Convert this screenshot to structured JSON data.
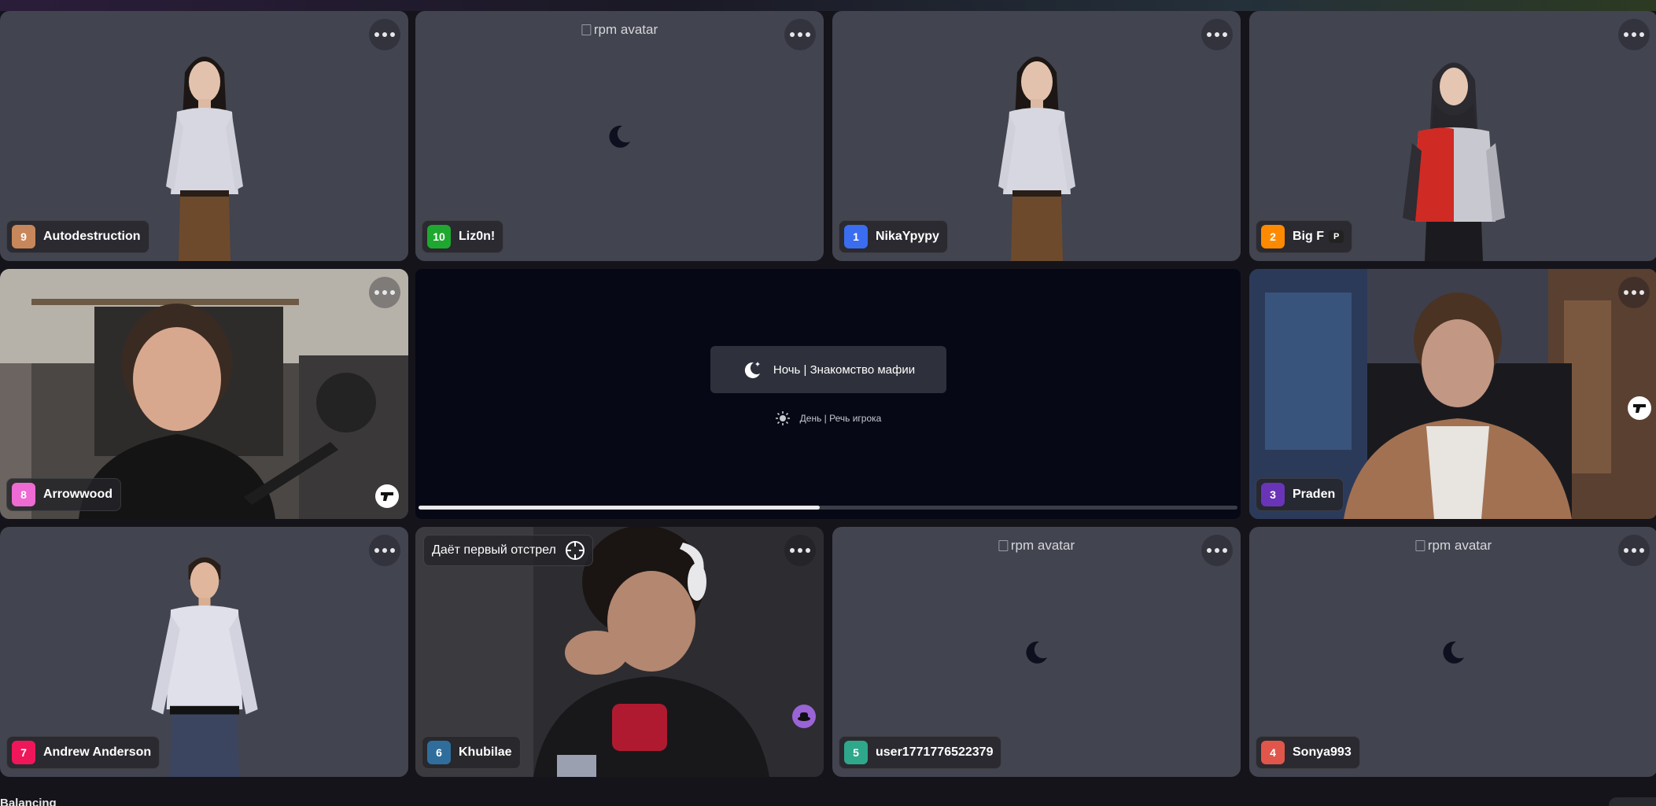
{
  "tiles": [
    {
      "id": 9,
      "name": "Autodestruction",
      "color": "#c8875a",
      "type": "avatar"
    },
    {
      "id": 10,
      "name": "Liz0n!",
      "color": "#1fa82f",
      "type": "broken",
      "alt": "rpm avatar"
    },
    {
      "id": 1,
      "name": "NikaYpypy",
      "color": "#3a6df0",
      "type": "avatar"
    },
    {
      "id": 2,
      "name": "Big F",
      "color": "#ff8a00",
      "type": "avatar",
      "badge": "P"
    },
    {
      "id": 8,
      "name": "Arrowwood",
      "color": "#ee6bd3",
      "type": "camera",
      "icon": "gun-icon"
    },
    {
      "id": 3,
      "name": "Praden",
      "color": "#6a34b8",
      "type": "camera",
      "icon": "gun-icon"
    },
    {
      "id": 7,
      "name": "Andrew Anderson",
      "color": "#f0165a",
      "type": "avatar"
    },
    {
      "id": 6,
      "name": "Khubilae",
      "color": "#2f6e9c",
      "type": "camera",
      "icon": "hat-icon",
      "overlay": "Даёт первый отстрел"
    },
    {
      "id": 5,
      "name": "user1771776522379",
      "color": "#2fa78a",
      "type": "broken",
      "alt": "rpm avatar"
    },
    {
      "id": 4,
      "name": "Sonya993",
      "color": "#e0564a",
      "type": "broken",
      "alt": "rpm avatar"
    }
  ],
  "phase": {
    "current": "Ночь | Знакомство мафии",
    "next": "День | Речь игрока",
    "progress": 0.49
  },
  "footer": {
    "label": "Balancing"
  }
}
